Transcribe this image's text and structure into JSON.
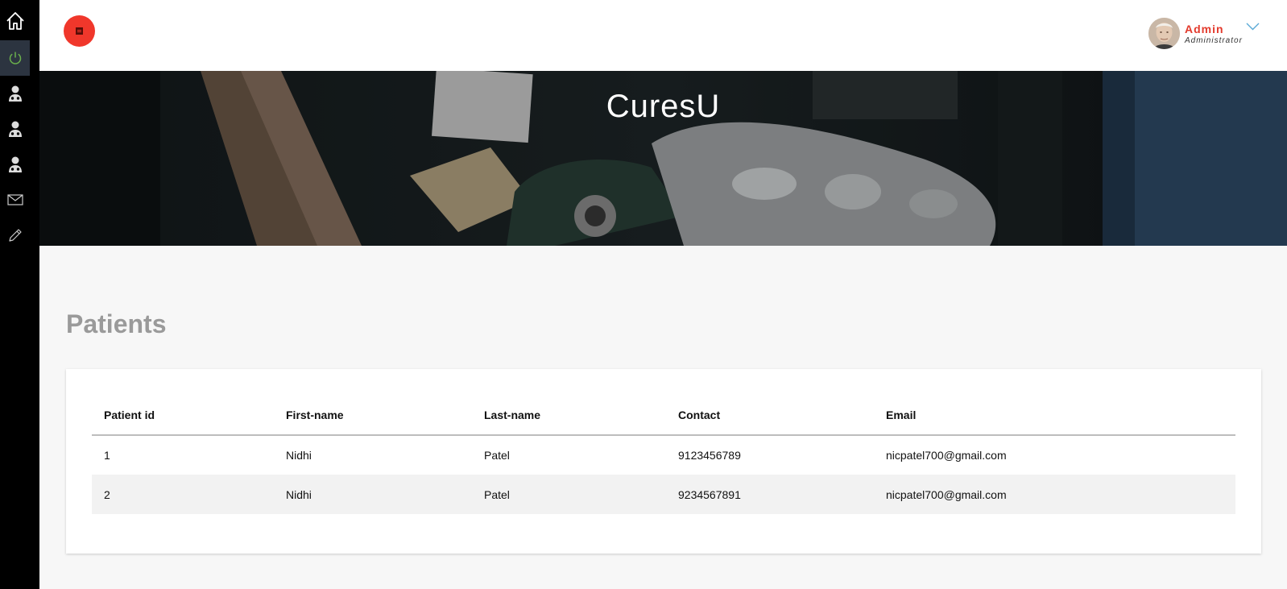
{
  "sidebar": {
    "items": [
      {
        "icon": "home-icon",
        "active": false
      },
      {
        "icon": "power-icon",
        "active": true
      },
      {
        "icon": "doctor-icon",
        "active": false
      },
      {
        "icon": "patient-icon",
        "active": false
      },
      {
        "icon": "staff-icon",
        "active": false
      },
      {
        "icon": "mail-icon",
        "active": false
      },
      {
        "icon": "pencil-icon",
        "active": false
      }
    ]
  },
  "header": {
    "menu_icon": "menu-icon",
    "user": {
      "name": "Admin",
      "role": "Administrator",
      "dropdown_icon": "chevron-down-icon"
    }
  },
  "banner": {
    "title": "CuresU"
  },
  "main": {
    "title": "Patients",
    "table": {
      "columns": [
        "Patient id",
        "First-name",
        "Last-name",
        "Contact",
        "Email"
      ],
      "rows": [
        [
          "1",
          "Nidhi",
          "Patel",
          "9123456789",
          "nicpatel700@gmail.com"
        ],
        [
          "2",
          "Nidhi",
          "Patel",
          "9234567891",
          "nicpatel700@gmail.com"
        ]
      ]
    }
  },
  "colors": {
    "accent": "#f0372b",
    "sidebar_bg": "#000000",
    "sidebar_active": "#2c3440",
    "power_icon": "#6ab04c"
  }
}
